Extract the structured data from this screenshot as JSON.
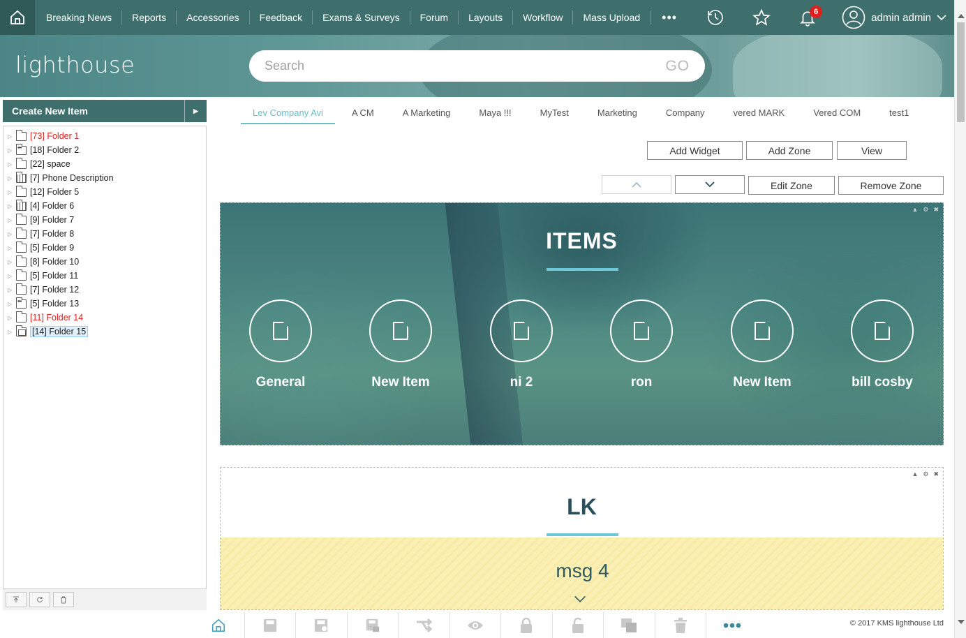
{
  "nav": {
    "items": [
      "Breaking News",
      "Reports",
      "Accessories",
      "Feedback",
      "Exams & Surveys",
      "Forum",
      "Layouts",
      "Workflow",
      "Mass Upload"
    ],
    "more": "•••",
    "notifications_count": "6",
    "user_name": "admin admin"
  },
  "header": {
    "logo": "lighthouse",
    "search_placeholder": "Search",
    "go_label": "GO"
  },
  "sidebar": {
    "create_label": "Create New Item",
    "tree": [
      {
        "count": "[73]",
        "name": "Folder 1",
        "red": true,
        "icon": "folder"
      },
      {
        "count": "[18]",
        "name": "Folder 2",
        "red": false,
        "icon": "dots"
      },
      {
        "count": "[22]",
        "name": "space",
        "red": false,
        "icon": "folder"
      },
      {
        "count": "[7]",
        "name": "Phone Description",
        "red": false,
        "icon": "grid"
      },
      {
        "count": "[12]",
        "name": "Folder 5",
        "red": false,
        "icon": "folder"
      },
      {
        "count": "[4]",
        "name": "Folder 6",
        "red": false,
        "icon": "grid"
      },
      {
        "count": "[9]",
        "name": "Folder 7",
        "red": false,
        "icon": "folder"
      },
      {
        "count": "[7]",
        "name": "Folder 8",
        "red": false,
        "icon": "folder"
      },
      {
        "count": "[5]",
        "name": "Folder 9",
        "red": false,
        "icon": "folder"
      },
      {
        "count": "[8]",
        "name": "Folder 10",
        "red": false,
        "icon": "folder"
      },
      {
        "count": "[5]",
        "name": "Folder 11",
        "red": false,
        "icon": "folder"
      },
      {
        "count": "[7]",
        "name": "Folder 12",
        "red": false,
        "icon": "folder"
      },
      {
        "count": "[5]",
        "name": "Folder 13",
        "red": false,
        "icon": "dots"
      },
      {
        "count": "[11]",
        "name": "Folder 14",
        "red": true,
        "icon": "folder"
      },
      {
        "count": "[14]",
        "name": "Folder 15",
        "red": false,
        "icon": "img",
        "selected": true
      }
    ]
  },
  "tabs": [
    "Lev Company Avi",
    "A CM",
    "A Marketing",
    "Maya !!!",
    "MyTest",
    "Marketing",
    "Company",
    "vered MARK",
    "Vered COM",
    "test1"
  ],
  "toolbar": {
    "add_widget": "Add Widget",
    "add_zone": "Add Zone",
    "view": "View",
    "edit_zone": "Edit Zone",
    "remove_zone": "Remove Zone"
  },
  "items_zone": {
    "title": "ITEMS",
    "items": [
      "General",
      "New Item",
      "ni 2",
      "ron",
      "New Item",
      "bill cosby"
    ]
  },
  "lk_zone": {
    "title": "LK",
    "message": "msg 4"
  },
  "footer": {
    "copyright": "© 2017 KMS lighthouse Ltd"
  },
  "colors": {
    "nav_bg": "#3e6f6c",
    "accent": "#6cc8d4",
    "badge": "#e01f1f"
  }
}
